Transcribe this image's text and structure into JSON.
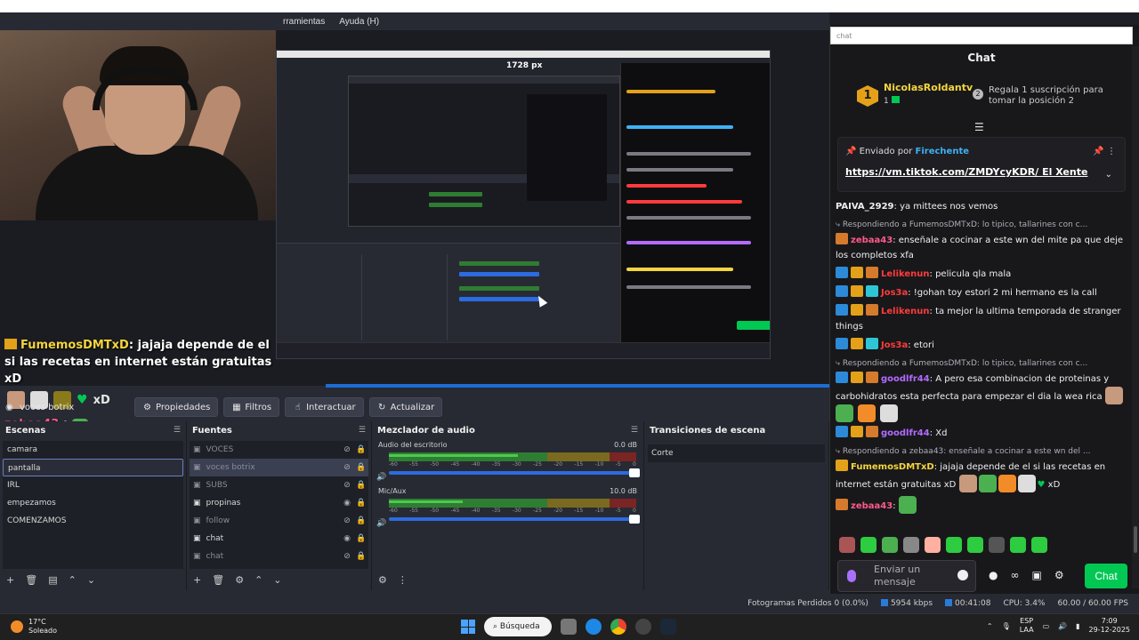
{
  "obs": {
    "menu": [
      "rramientas",
      "Ayuda (H)"
    ],
    "preview": {
      "canvas_label": "1728 px",
      "overlay_chat": {
        "user1": "FumemosDMTxD",
        "msg1": ": jajaja depende de el si las recetas en internet están gratuitas xD",
        "emote_tail": "xD",
        "user2": "zebaa43",
        "msg2": ":"
      }
    },
    "toolbar": {
      "source_name": "voces botrix",
      "properties": "Propiedades",
      "filters": "Filtros",
      "interact": "Interactuar",
      "refresh": "Actualizar"
    },
    "scenes": {
      "title": "Escenas",
      "items": [
        "camara",
        "pantalla",
        "IRL",
        "empezamos",
        "COMENZAMOS"
      ],
      "active_index": 1
    },
    "sources": {
      "title": "Fuentes",
      "items": [
        {
          "name": "VOCES",
          "visible": false
        },
        {
          "name": "voces botrix",
          "visible": false
        },
        {
          "name": "SUBS",
          "visible": false
        },
        {
          "name": "propinas",
          "visible": true
        },
        {
          "name": "follow",
          "visible": false
        },
        {
          "name": "chat",
          "visible": true
        },
        {
          "name": "chat",
          "visible": false
        }
      ]
    },
    "mixer": {
      "title": "Mezclador de audio",
      "channels": [
        {
          "name": "Audio del escritorio",
          "db": "0.0 dB",
          "level": 0.52
        },
        {
          "name": "Mic/Aux",
          "db": "10.0 dB",
          "level": 0.3
        }
      ],
      "ticks": [
        "-60",
        "-55",
        "-50",
        "-45",
        "-40",
        "-35",
        "-30",
        "-25",
        "-20",
        "-15",
        "-10",
        "-5",
        "0"
      ]
    },
    "transitions": {
      "title": "Transiciones de escena",
      "selected": "Corte"
    },
    "status": {
      "dropped": "Fotogramas Perdidos 0 (0.0%)",
      "kbps": "5954 kbps",
      "time": "00:41:08",
      "cpu": "CPU: 3.4%",
      "fps": "60.00 / 60.00 FPS"
    }
  },
  "chat": {
    "address": "chat",
    "header": "Chat",
    "leader": {
      "rank": "1",
      "name": "NicolasRoldantv",
      "count": "1",
      "second_rank": "2",
      "second_text": "Regala 1 suscripción para tomar la posición 2"
    },
    "pinned": {
      "by_label": "Enviado por",
      "by_user": "Firechente",
      "link": "https://vm.tiktok.com/ZMDYcyKDR/",
      "link_suffix": "El Xente"
    },
    "messages": [
      {
        "user": "PAIVA_2929",
        "color": "#efeff1",
        "text": ": ya mittees nos vemos",
        "reply": "",
        "badges": []
      },
      {
        "user": "zebaa43",
        "color": "#ff5a8a",
        "text": ": enseñale a cocinar a este wn del mite pa que deje los completos xfa",
        "reply": "Respondiendo a FumemosDMTxD: lo tipico, tallarines con c...",
        "badges": [
          "orange"
        ]
      },
      {
        "user": "Lelikenun",
        "color": "#ff3b3b",
        "text": ": pelicula qla mala",
        "reply": "",
        "badges": [
          "blue",
          "gold",
          "orange"
        ]
      },
      {
        "user": "Jos3a",
        "color": "#ff3b3b",
        "text": ": !gohan toy estori 2 mi hermano es la call",
        "reply": "",
        "badges": [
          "blue",
          "gold",
          "teal"
        ]
      },
      {
        "user": "Lelikenun",
        "color": "#ff3b3b",
        "text": ": ta mejor la ultima temporada de stranger things",
        "reply": "",
        "badges": [
          "blue",
          "gold",
          "orange"
        ]
      },
      {
        "user": "Jos3a",
        "color": "#ff3b3b",
        "text": ": etori",
        "reply": "",
        "badges": [
          "blue",
          "gold",
          "teal"
        ]
      },
      {
        "user": "goodlfr44",
        "color": "#b36bff",
        "text": ": A pero esa combinacion de proteinas y carbohidratos esta perfecta para empezar el dia la wea rica",
        "reply": "Respondiendo a FumemosDMTxD: lo tipico, tallarines con c...",
        "badges": [
          "blue",
          "gold",
          "orange"
        ]
      },
      {
        "user": "goodlfr44",
        "color": "#b36bff",
        "text": ": Xd",
        "reply": "",
        "badges": [
          "blue",
          "gold",
          "orange"
        ]
      },
      {
        "user": "FumemosDMTxD",
        "color": "#f5d53c",
        "text": ": jajaja depende de el si las recetas en internet están gratuitas xD",
        "reply": "Respondiendo a zebaa43: enseñale a cocinar a este wn del ...",
        "badges": [
          "gold"
        ],
        "tail": "xD"
      },
      {
        "user": "zebaa43",
        "color": "#ff5a8a",
        "text": ":",
        "reply": "",
        "badges": [
          "orange"
        ]
      }
    ],
    "input_placeholder": "Enviar un mensaje",
    "send_label": "Chat",
    "send_color": "#00c853",
    "icon_infinity": "∞"
  },
  "taskbar": {
    "temp": "17°C",
    "weather": "Soleado",
    "search": "Búsqueda",
    "lang1": "ESP",
    "lang2": "LAA",
    "time": "7:09",
    "date": "29-12-2025"
  }
}
